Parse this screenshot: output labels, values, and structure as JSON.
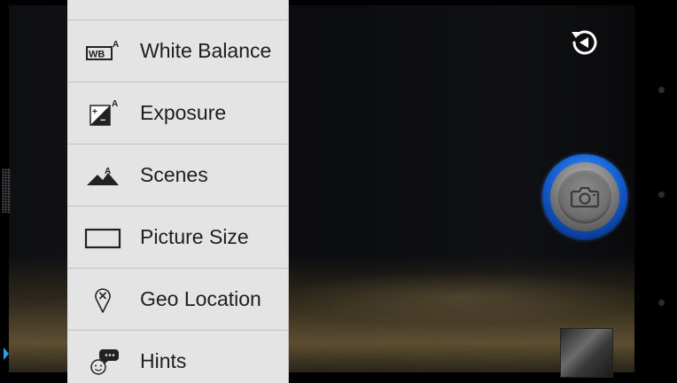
{
  "menu": {
    "items": [
      {
        "label": "White Balance",
        "icon": "white-balance-auto-icon"
      },
      {
        "label": "Exposure",
        "icon": "exposure-auto-icon"
      },
      {
        "label": "Scenes",
        "icon": "scene-auto-icon"
      },
      {
        "label": "Picture Size",
        "icon": "picture-size-icon"
      },
      {
        "label": "Geo Location",
        "icon": "geo-location-icon"
      },
      {
        "label": "Hints",
        "icon": "hints-icon"
      }
    ],
    "wb_glyph": "WB",
    "auto_glyph": "A"
  },
  "controls": {
    "switch_camera_icon": "switch-camera-icon",
    "shutter_icon": "camera-icon",
    "accent_color": "#1663d6"
  }
}
